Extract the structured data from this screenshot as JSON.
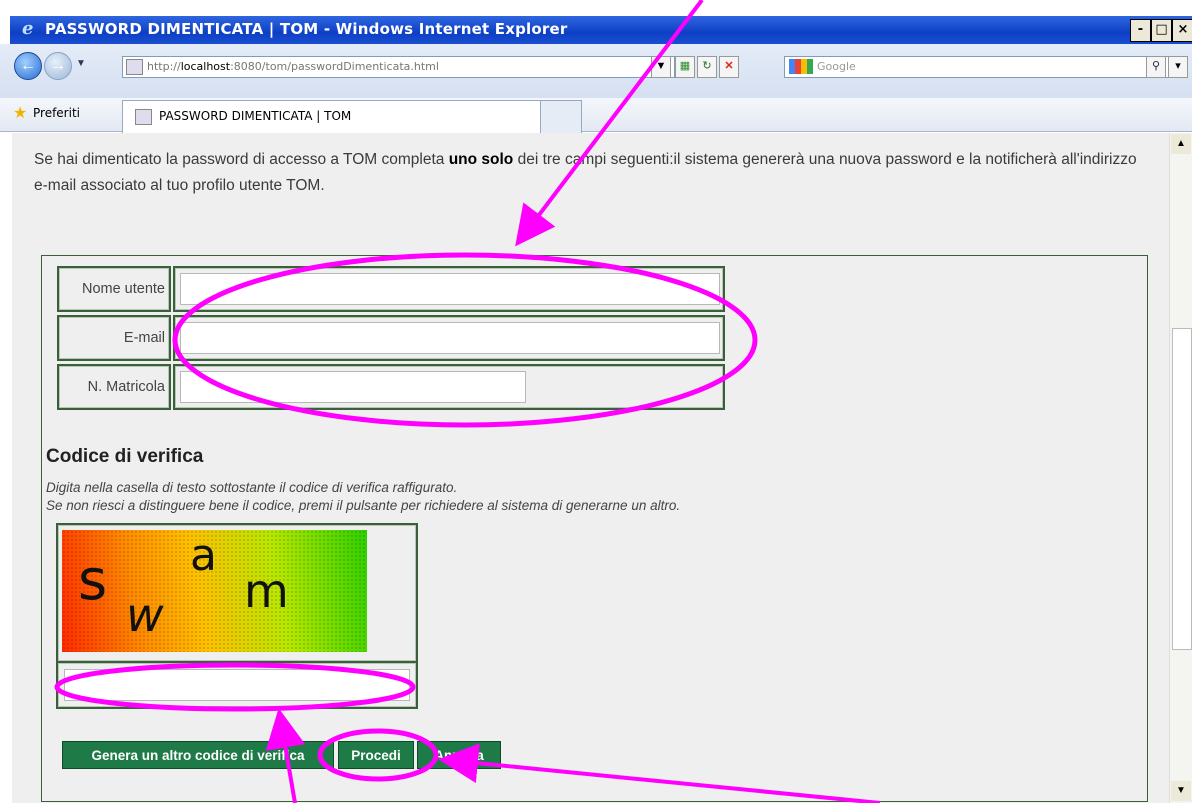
{
  "window": {
    "title": "PASSWORD DIMENTICATA | TOM - Windows Internet Explorer",
    "minimize": "-",
    "maximize": "□",
    "close": "×"
  },
  "nav": {
    "address_prefix": "http://",
    "address_host": "localhost",
    "address_rest": ":8080/tom/passwordDimenticata.html",
    "search_placeholder": "Google"
  },
  "favorites": {
    "label": "Preferiti",
    "tab_title": "PASSWORD DIMENTICATA | TOM"
  },
  "intro": {
    "part1": "Se hai dimenticato la password di accesso a TOM completa ",
    "bold": "uno solo",
    "part2": " dei tre campi seguenti:il sistema genererà una nuova password e la notificherà all'indirizzo e-mail associato al tuo profilo utente TOM."
  },
  "form": {
    "username_label": "Nome utente",
    "email_label": "E-mail",
    "matricola_label": "N. Matricola",
    "username_value": "",
    "email_value": "",
    "matricola_value": ""
  },
  "captcha": {
    "title": "Codice di verifica",
    "desc_line1": "Digita nella casella di testo sottostante il codice di verifica raffigurato.",
    "desc_line2": "Se non riesci a distinguere bene il codice, premi il pulsante per richiedere al sistema di generarne un altro.",
    "chars": [
      "s",
      "w",
      "a",
      "m"
    ],
    "input_value": ""
  },
  "buttons": {
    "regenerate": "Genera un altro codice di verifica",
    "proceed": "Procedi",
    "cancel": "Annulla"
  },
  "colors": {
    "accent_green": "#1e7a46",
    "annotation_magenta": "#ff00ff",
    "titlebar_blue": "#0d3fc5"
  }
}
